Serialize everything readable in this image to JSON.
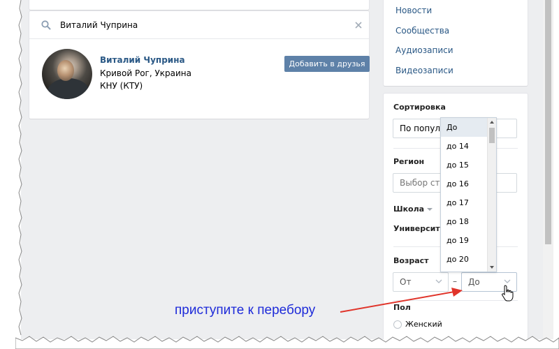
{
  "search": {
    "query": "Виталий Чуприна",
    "placeholder": ""
  },
  "result": {
    "name": "Виталий Чуприна",
    "city": "Кривой Рог, Украина",
    "university": "КНУ (КТУ)",
    "add_friend_label": "Добавить в друзья"
  },
  "menu": {
    "items": [
      {
        "label": "Новости"
      },
      {
        "label": "Сообщества"
      },
      {
        "label": "Аудиозаписи"
      },
      {
        "label": "Видеозаписи"
      }
    ]
  },
  "filters": {
    "sort_label": "Сортировка",
    "sort_value": "По популярности",
    "region_label": "Регион",
    "country_placeholder": "Выбор страны",
    "school_label": "Школа",
    "university_label": "Университет",
    "age_label": "Возраст",
    "age_from": "От",
    "age_separator": "–",
    "age_to": "До",
    "gender_label": "Пол",
    "gender_female": "Женский"
  },
  "age_dropdown": {
    "options": [
      "До",
      "до 14",
      "до 15",
      "до 16",
      "до 17",
      "до 18",
      "до 19",
      "до 20"
    ],
    "selected": "До"
  },
  "annotation": {
    "text": "приступите к перебору"
  },
  "colors": {
    "link": "#2a5885",
    "button": "#5e81a8",
    "background": "#edeef0",
    "annotation_text": "#1e2bd9",
    "annotation_arrow": "#e0342a"
  }
}
